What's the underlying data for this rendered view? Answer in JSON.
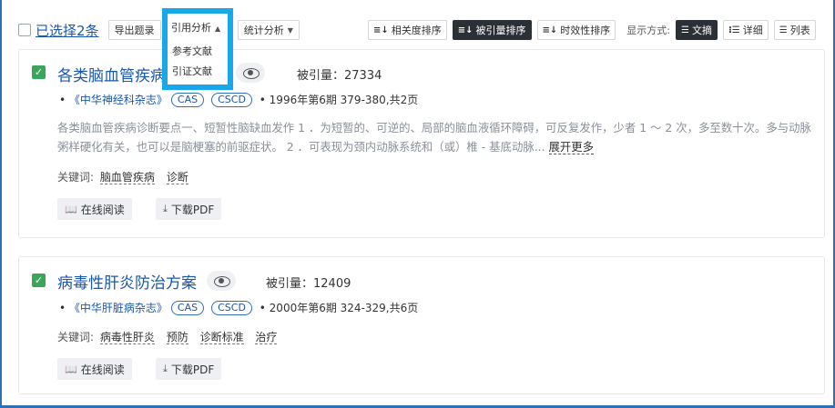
{
  "toolbar": {
    "selected_text": "已选择2条",
    "export_label": "导出题录",
    "citation_label": "引用分析",
    "stats_label": "统计分析",
    "sort_relevance": "相关度排序",
    "sort_cited": "被引量排序",
    "sort_timeliness": "时效性排序",
    "display_label": "显示方式:",
    "view_abstract": "文摘",
    "view_detail": "详细",
    "view_list": "列表"
  },
  "dropdown": {
    "items": [
      "参考文献",
      "引证文献"
    ]
  },
  "results": [
    {
      "title": "各类脑血管疾病",
      "cited": "被引量：27334",
      "journal": "《中华神经科杂志》",
      "tags": [
        "CAS",
        "CSCD"
      ],
      "issue": "1996年第6期 379-380,共2页",
      "abstract": "各类脑血管疾病诊断要点一、短暂性脑缺血发作 1 ．为短暂的、可逆的、局部的脑血液循环障碍，可反复发作，少者 1 ～ 2 次，多至数十次。多与动脉粥样硬化有关，也可以是脑梗塞的前驱症状。 2 ．可表现为颈内动脉系统和（或）椎 - 基底动脉...",
      "more": "展开更多",
      "keywords_label": "关键词:",
      "keywords": [
        "脑血管疾病",
        "诊断"
      ],
      "read_label": "在线阅读",
      "pdf_label": "下载PDF"
    },
    {
      "title": "病毒性肝炎防治方案",
      "cited": "被引量：12409",
      "journal": "《中华肝脏病杂志》",
      "tags": [
        "CAS",
        "CSCD"
      ],
      "issue": "2000年第6期 324-329,共6页",
      "keywords_label": "关键词:",
      "keywords": [
        "病毒性肝炎",
        "预防",
        "诊断标准",
        "治疗"
      ],
      "read_label": "在线阅读",
      "pdf_label": "下载PDF"
    }
  ]
}
